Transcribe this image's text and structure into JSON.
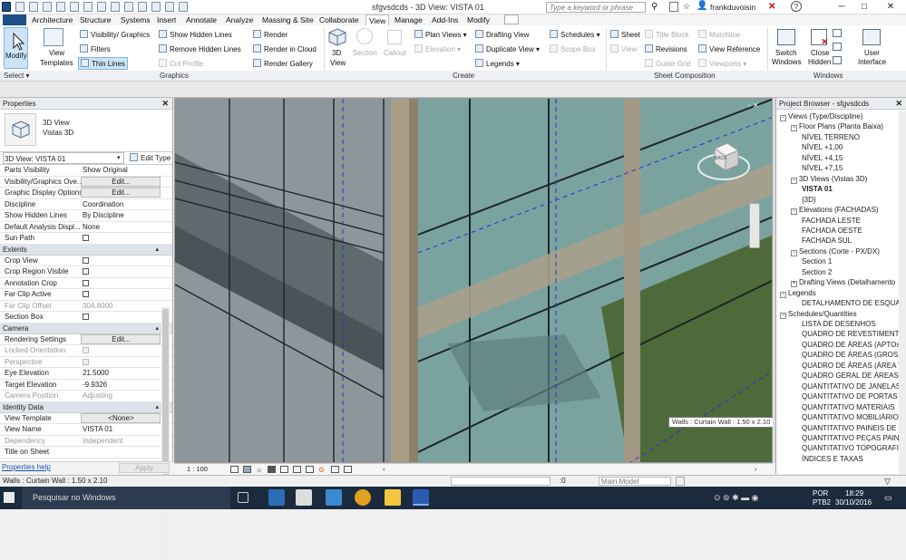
{
  "titlebar": {
    "doc_title": "sfgvsdcds - 3D View: VISTA 01",
    "search_placeholder": "Type a keyword or phrase",
    "user": "frankduvoisin"
  },
  "tabs": [
    "Architecture",
    "Structure",
    "Systems",
    "Insert",
    "Annotate",
    "Analyze",
    "Massing & Site",
    "Collaborate",
    "View",
    "Manage",
    "Add-Ins",
    "Modify"
  ],
  "active_tab": "View",
  "ribbon": {
    "modify": "Modify",
    "select": "Select",
    "view_templates": [
      "View",
      "Templates"
    ],
    "visibility_graphics": "Visibility/ Graphics",
    "filters": "Filters",
    "thin_lines": "Thin  Lines",
    "show_hidden_lines": "Show  Hidden Lines",
    "remove_hidden_lines": "Remove  Hidden Lines",
    "cut_profile": "Cut  Profile",
    "render": "Render",
    "render_cloud": "Render  in Cloud",
    "render_gallery": "Render  Gallery",
    "graphics_label": "Graphics",
    "view_3d": [
      "3D",
      "View"
    ],
    "section": "Section",
    "callout": "Callout",
    "plan_views": "Plan  Views",
    "elevation": "Elevation",
    "drafting_view": "Drafting  View",
    "duplicate_view": "Duplicate  View",
    "legends": "Legends",
    "schedules": "Schedules",
    "scope_box": "Scope  Box",
    "create_label": "Create",
    "sheet": "Sheet",
    "view": "View",
    "title_block": "Title  Block",
    "revisions": "Revisions",
    "guide_grid": "Guide  Grid",
    "matchline": "Matchline",
    "view_reference": "View  Reference",
    "viewports": "Viewports",
    "sheet_comp_label": "Sheet Composition",
    "switch_windows": [
      "Switch",
      "Windows"
    ],
    "close_hidden": [
      "Close",
      "Hidden"
    ],
    "user_interface": [
      "User",
      "Interface"
    ],
    "windows_label": "Windows"
  },
  "properties": {
    "title": "Properties",
    "type_name": [
      "3D View",
      "Vistas 3D"
    ],
    "view_selector": "3D View: VISTA 01",
    "edit_type": "Edit Type",
    "rows_top": [
      {
        "k": "Parts Visibility",
        "v": "Show Original"
      },
      {
        "k": "Visibility/Graphics Ove...",
        "v": "Edit...",
        "btn": true
      },
      {
        "k": "Graphic Display Options",
        "v": "Edit...",
        "btn": true
      },
      {
        "k": "Discipline",
        "v": "Coordination"
      },
      {
        "k": "Show Hidden Lines",
        "v": "By Discipline"
      },
      {
        "k": "Default Analysis Displ...",
        "v": "None"
      },
      {
        "k": "Sun Path",
        "chk": true
      }
    ],
    "extents": "Extents",
    "rows_extents": [
      {
        "k": "Crop View",
        "chk": true
      },
      {
        "k": "Crop Region Visible",
        "chk": true
      },
      {
        "k": "Annotation Crop",
        "chk": true
      },
      {
        "k": "Far Clip Active",
        "chk": true
      },
      {
        "k": "Far Clip Offset",
        "v": "304.8000",
        "dis": true
      },
      {
        "k": "Section Box",
        "chk": true
      }
    ],
    "camera": "Camera",
    "rows_camera": [
      {
        "k": "Rendering Settings",
        "v": "Edit...",
        "btn": true
      },
      {
        "k": "Locked Orientation",
        "chk": true,
        "dis": true
      },
      {
        "k": "Perspective",
        "chk": true,
        "dis": true
      },
      {
        "k": "Eye Elevation",
        "v": "21.5000"
      },
      {
        "k": "Target Elevation",
        "v": "-9.9326"
      },
      {
        "k": "Camera Position",
        "v": "Adjusting",
        "dis": true
      }
    ],
    "identity": "Identity Data",
    "rows_identity": [
      {
        "k": "View Template",
        "v": "<None>",
        "btn": true
      },
      {
        "k": "View Name",
        "v": "VISTA 01"
      },
      {
        "k": "Dependency",
        "v": "Independent",
        "dis": true
      },
      {
        "k": "Title on Sheet",
        "v": ""
      }
    ],
    "help": "Properties help",
    "apply": "Apply"
  },
  "viewport": {
    "scale": "1 : 100",
    "tooltip": "Walls : Curtain Wall : 1.50 x 2.10",
    "viewcube_face": "BACK"
  },
  "browser": {
    "title": "Project Browser - sfgvsdcds",
    "items": [
      {
        "t": "Views (Type/Discipline)",
        "l": 0,
        "tog": "−"
      },
      {
        "t": "Floor Plans (Planta Baixa)",
        "l": 1,
        "tog": "−"
      },
      {
        "t": "NÍVEL TERRENO",
        "l": 2
      },
      {
        "t": "NÍVEL +1,00",
        "l": 2
      },
      {
        "t": "NÍVEL +4,15",
        "l": 2
      },
      {
        "t": "NÍVEL +7,15",
        "l": 2
      },
      {
        "t": "3D Views (Vistas 3D)",
        "l": 1,
        "tog": "−"
      },
      {
        "t": "VISTA 01",
        "l": 2,
        "sel": true
      },
      {
        "t": "{3D}",
        "l": 2
      },
      {
        "t": "Elevations (FACHADAS)",
        "l": 1,
        "tog": "−"
      },
      {
        "t": "FACHADA LESTE",
        "l": 2
      },
      {
        "t": "FACHADA OESTE",
        "l": 2
      },
      {
        "t": "FACHADA SUL",
        "l": 2
      },
      {
        "t": "Sections (Corte - PX/DX)",
        "l": 1,
        "tog": "−"
      },
      {
        "t": "Section 1",
        "l": 2
      },
      {
        "t": "Section 2",
        "l": 2
      },
      {
        "t": "Drafting Views (Detalhamento",
        "l": 1,
        "tog": "+"
      },
      {
        "t": "Legends",
        "l": 0,
        "tog": "−"
      },
      {
        "t": "DETALHAMENTO DE ESQUADR",
        "l": 2
      },
      {
        "t": "Schedules/Quantities",
        "l": 0,
        "tog": "−"
      },
      {
        "t": "LISTA DE DESENHOS",
        "l": 2
      },
      {
        "t": "QUADRO DE REVESTIMENTOS",
        "l": 2
      },
      {
        "t": "QUADRO DE ÁREAS (APTOs)",
        "l": 2
      },
      {
        "t": "QUADRO DE ÁREAS (GROSS BU",
        "l": 2
      },
      {
        "t": "QUADRO DE ÁREAS (ÁREA TO",
        "l": 2
      },
      {
        "t": "QUADRO GERAL DE ÁREAS INT",
        "l": 2
      },
      {
        "t": "QUANTITATIVO DE JANELAS",
        "l": 2
      },
      {
        "t": "QUANTITATIVO DE PORTAS E G",
        "l": 2
      },
      {
        "t": "QUANTITATIVO MATERIAIS",
        "l": 2
      },
      {
        "t": "QUANTITATIVO MOBILIÁRIO",
        "l": 2
      },
      {
        "t": "QUANTITATIVO PAINEIS DE VID",
        "l": 2
      },
      {
        "t": "QUANTITATIVO PEÇAS PAINEL",
        "l": 2
      },
      {
        "t": "QUANTITATIVO TOPOGRAFIA (",
        "l": 2
      },
      {
        "t": "ÍNDICES E TAXAS",
        "l": 2
      }
    ]
  },
  "status": {
    "text": "Walls : Curtain Wall : 1.50 x 2.10",
    "zero": ":0",
    "model": "Main Model"
  },
  "taskbar": {
    "search": "Pesquisar no Windows",
    "lang": [
      "POR",
      "PTB2"
    ],
    "time": "18:29",
    "date": "30/10/2016"
  }
}
